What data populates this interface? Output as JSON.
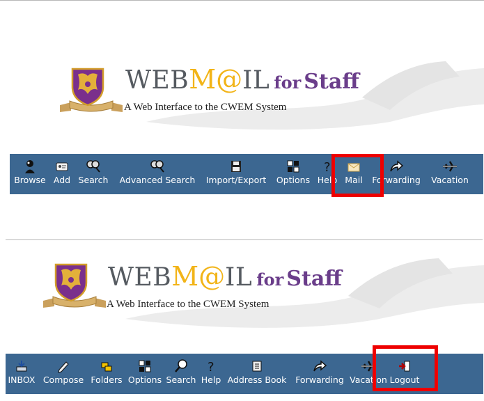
{
  "panels": [
    {
      "banner": {
        "web": "WEB",
        "at": "M@",
        "il": "IL",
        "for": "for",
        "staff": "Staff",
        "subtitle": "A Web Interface to the CWEM System"
      },
      "toolbar": [
        {
          "label": "Browse",
          "icon": "person-icon"
        },
        {
          "label": "Add",
          "icon": "card-icon"
        },
        {
          "label": "Search",
          "icon": "magnifier-icon"
        },
        {
          "label": "Advanced Search",
          "icon": "magnifier-icon"
        },
        {
          "label": "Import/Export",
          "icon": "disk-icon"
        },
        {
          "label": "Options",
          "icon": "options-icon"
        },
        {
          "label": "Help",
          "icon": "question-icon"
        },
        {
          "label": "Mail",
          "icon": "envelope-icon",
          "highlighted": true
        },
        {
          "label": "Forwarding",
          "icon": "forward-arrow-icon"
        },
        {
          "label": "Vacation",
          "icon": "airplane-icon"
        }
      ]
    },
    {
      "banner": {
        "web": "WEB",
        "at": "M@",
        "il": "IL",
        "for": "for",
        "staff": "Staff",
        "subtitle": "A Web Interface to the CWEM System"
      },
      "toolbar": [
        {
          "label": "INBOX",
          "icon": "inbox-icon"
        },
        {
          "label": "Compose",
          "icon": "pencil-icon"
        },
        {
          "label": "Folders",
          "icon": "folders-icon"
        },
        {
          "label": "Options",
          "icon": "options-icon"
        },
        {
          "label": "Search",
          "icon": "magnifier-icon"
        },
        {
          "label": "Help",
          "icon": "question-icon"
        },
        {
          "label": "Address Book",
          "icon": "address-book-icon"
        },
        {
          "label": "Forwarding",
          "icon": "forward-arrow-icon"
        },
        {
          "label": "Vacation",
          "icon": "airplane-icon"
        },
        {
          "label": "Logout",
          "icon": "logout-icon",
          "highlighted": true
        }
      ]
    }
  ],
  "colors": {
    "toolbar_bg": "#3c6791",
    "highlight": "#ee0000",
    "title_gray": "#555a60",
    "title_gold": "#f2b418",
    "title_purple": "#6a3d8a"
  }
}
